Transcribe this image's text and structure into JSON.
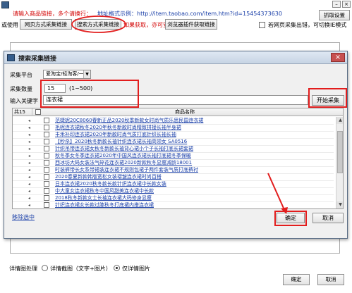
{
  "main": {
    "hint_prefix": "请输入商品链接，多个请换行：",
    "hint_example": "地址格式示例：http://item.taobao.com/item.htm?id=15454373630",
    "fetch_button": "抓取设置",
    "use_label": "或使用",
    "btn_web": "网页方式采集链接",
    "btn_search": "搜索方式采集链接",
    "hint_get": "如果获取，亦可安装",
    "btn_plugin": "浏览器插件获取链接",
    "chk_label": "若网页采集出错，可切换IE模式",
    "detail_label": "详情图处理",
    "detail_opt1": "详情截图（文字+图片）",
    "detail_opt2": "仅详情图片",
    "ok_button": "确定",
    "cancel_button": "取消"
  },
  "dialog": {
    "title": "搜索采集链接",
    "platform_label": "采集平台",
    "platform_value": "爱淘宝/轻淘客/一",
    "count_label": "采集数量",
    "count_value": "15",
    "count_range": "(1~500)",
    "keyword_label": "输入关键字",
    "keyword_value": "连衣裙",
    "start_button": "开始采集",
    "table": {
      "count_header": "共15",
      "name_header": "商品名称",
      "rows": [
        "范婕妮20C8060春新正品2020秋季新款女时尚气质乐思民国连衣裙",
        "毛呢连衣裙秋冬2020年秋冬新款时尚精致拼接长袖半身裙",
        "丰禾补印连衣裙2020年新款时尚气质打底针织长袖长袖",
        "【秒杀】2020秋冬新款长袖针织连衣裙长袖高领女 SA0516",
        "针织吊带连衣裙女秋冬新款长袖背心裙小个子长袖打底长裙套裙",
        "秋冬季女冬季连衣裙2020年中国风连衣裙长袖打底裙冬季保暖",
        "西冰坊大码女装法气碎花连衣裙2020新款秋冬显瘦减龄18001",
        "时装裤带长女系带裙装连衣裙不规则包裙子两件套装气质打底裤衬",
        "2020春夏新款韩版宽松女装褶皱连衣裙时尚百搭",
        "日本连衣裙2020秋冬款长款针织连衣裙中长款女装",
        "中大童女连衣裙秋冬中国风甜美连衣裙中长款",
        "2018秋冬新款女士长袖连衣裙大码修身显瘦",
        "针织连衣裙女长款过膝秋冬打底裙内搭连衣裙",
        "黑色裙子女秋冬长袖新款连衣裙气质"
      ]
    },
    "clear_link": "移除选中",
    "ok_button": "确定",
    "cancel_button": "取消"
  }
}
